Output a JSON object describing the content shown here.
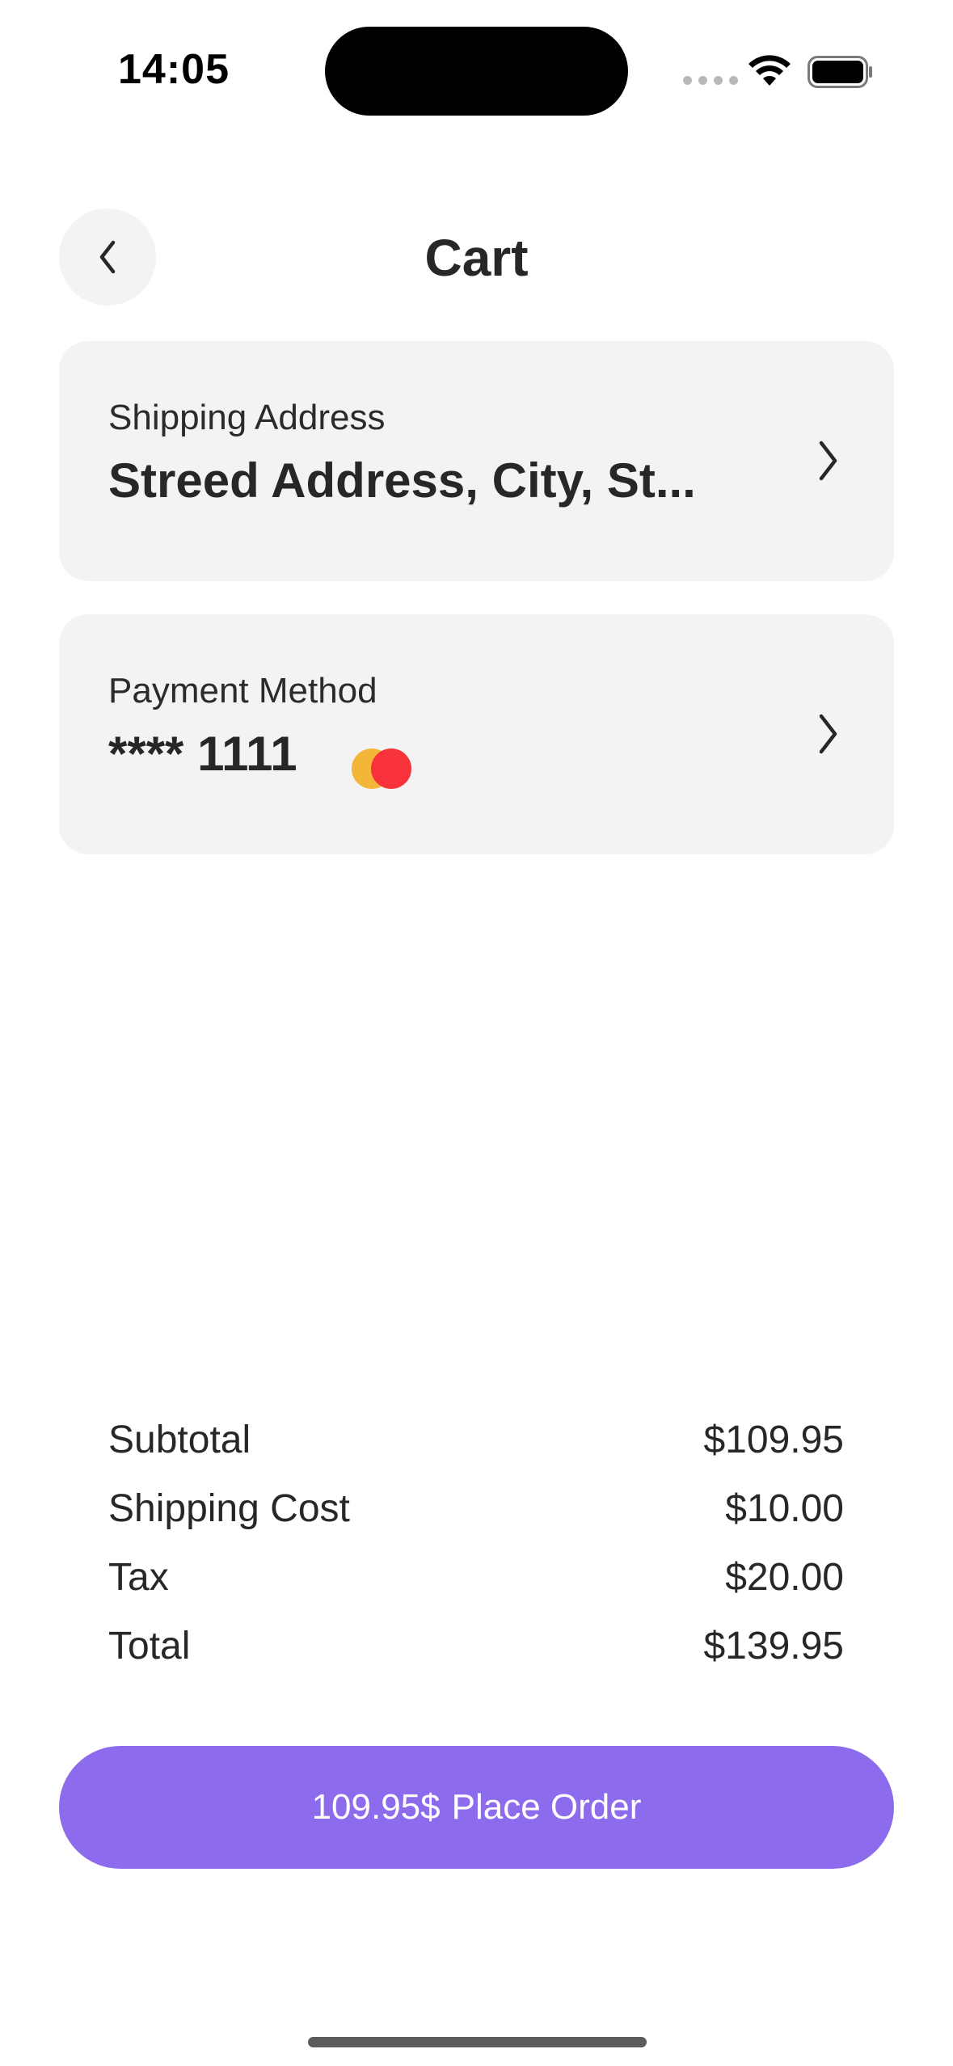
{
  "status_bar": {
    "time": "14:05"
  },
  "header": {
    "title": "Cart",
    "back_icon": "chevron-left-icon"
  },
  "shipping": {
    "label": "Shipping Address",
    "value": "Streed Address, City, St..."
  },
  "payment": {
    "label": "Payment Method",
    "value": "**** 1111",
    "card_brand_icon": "mastercard-icon"
  },
  "summary": {
    "rows": [
      {
        "label": "Subtotal",
        "value": "$109.95"
      },
      {
        "label": "Shipping Cost",
        "value": "$10.00"
      },
      {
        "label": "Tax",
        "value": "$20.00"
      },
      {
        "label": "Total",
        "value": "$139.95"
      }
    ]
  },
  "order_button": {
    "amount": "109.95$",
    "label": "Place Order"
  },
  "colors": {
    "accent": "#8c6ced",
    "card_background": "#f3f3f3",
    "text": "#272727",
    "mastercard_yellow": "#f3b638",
    "mastercard_red": "#f8323b"
  }
}
